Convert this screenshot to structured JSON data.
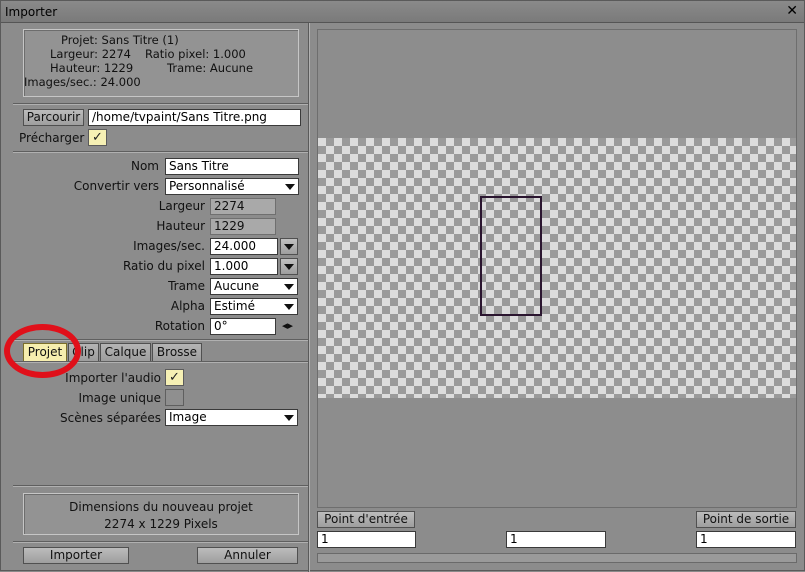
{
  "window": {
    "title": "Importer",
    "close_glyph": "✕"
  },
  "info": {
    "projet": "Projet: Sans Titre (1)",
    "largeur": "Largeur: 2274",
    "ratio": "Ratio pixel: 1.000",
    "hauteur": "Hauteur: 1229",
    "trame": "Trame: Aucune",
    "images": "Images/sec.: 24.000"
  },
  "file": {
    "browse_label": "Parcourir",
    "path": "/home/tvpaint/Sans Titre.png",
    "preload_label": "Précharger",
    "preload_checked": true
  },
  "form": {
    "nom_label": "Nom",
    "nom_value": "Sans Titre",
    "convert_label": "Convertir vers",
    "convert_value": "Personnalisé",
    "largeur_label": "Largeur",
    "largeur_value": "2274",
    "hauteur_label": "Hauteur",
    "hauteur_value": "1229",
    "fps_label": "Images/sec.",
    "fps_value": "24.000",
    "ratio_label": "Ratio du pixel",
    "ratio_value": "1.000",
    "trame_label": "Trame",
    "trame_value": "Aucune",
    "alpha_label": "Alpha",
    "alpha_value": "Estimé",
    "rotation_label": "Rotation",
    "rotation_value": "0°",
    "rotation_arrows": "◂▸"
  },
  "tabs": [
    {
      "label": "Projet",
      "active": true
    },
    {
      "label": "Clip",
      "active": false
    },
    {
      "label": "Calque",
      "active": false
    },
    {
      "label": "Brosse",
      "active": false
    }
  ],
  "options": {
    "audio_label": "Importer l'audio",
    "audio_checked": true,
    "single_label": "Image unique",
    "single_checked": false,
    "scenes_label": "Scènes séparées",
    "scenes_value": "Image"
  },
  "dimensions": {
    "title": "Dimensions du nouveau projet",
    "value": "2274 x 1229 Pixels"
  },
  "actions": {
    "import_label": "Importer",
    "cancel_label": "Annuler"
  },
  "timeline": {
    "in_label": "Point d'entrée",
    "out_label": "Point de sortie",
    "in_value": "1",
    "current_value": "1",
    "out_value": "1"
  },
  "colors": {
    "accent_check": "#f6f0b4",
    "highlight_ring": "#e0101a",
    "frame_box": "#2b1630"
  }
}
